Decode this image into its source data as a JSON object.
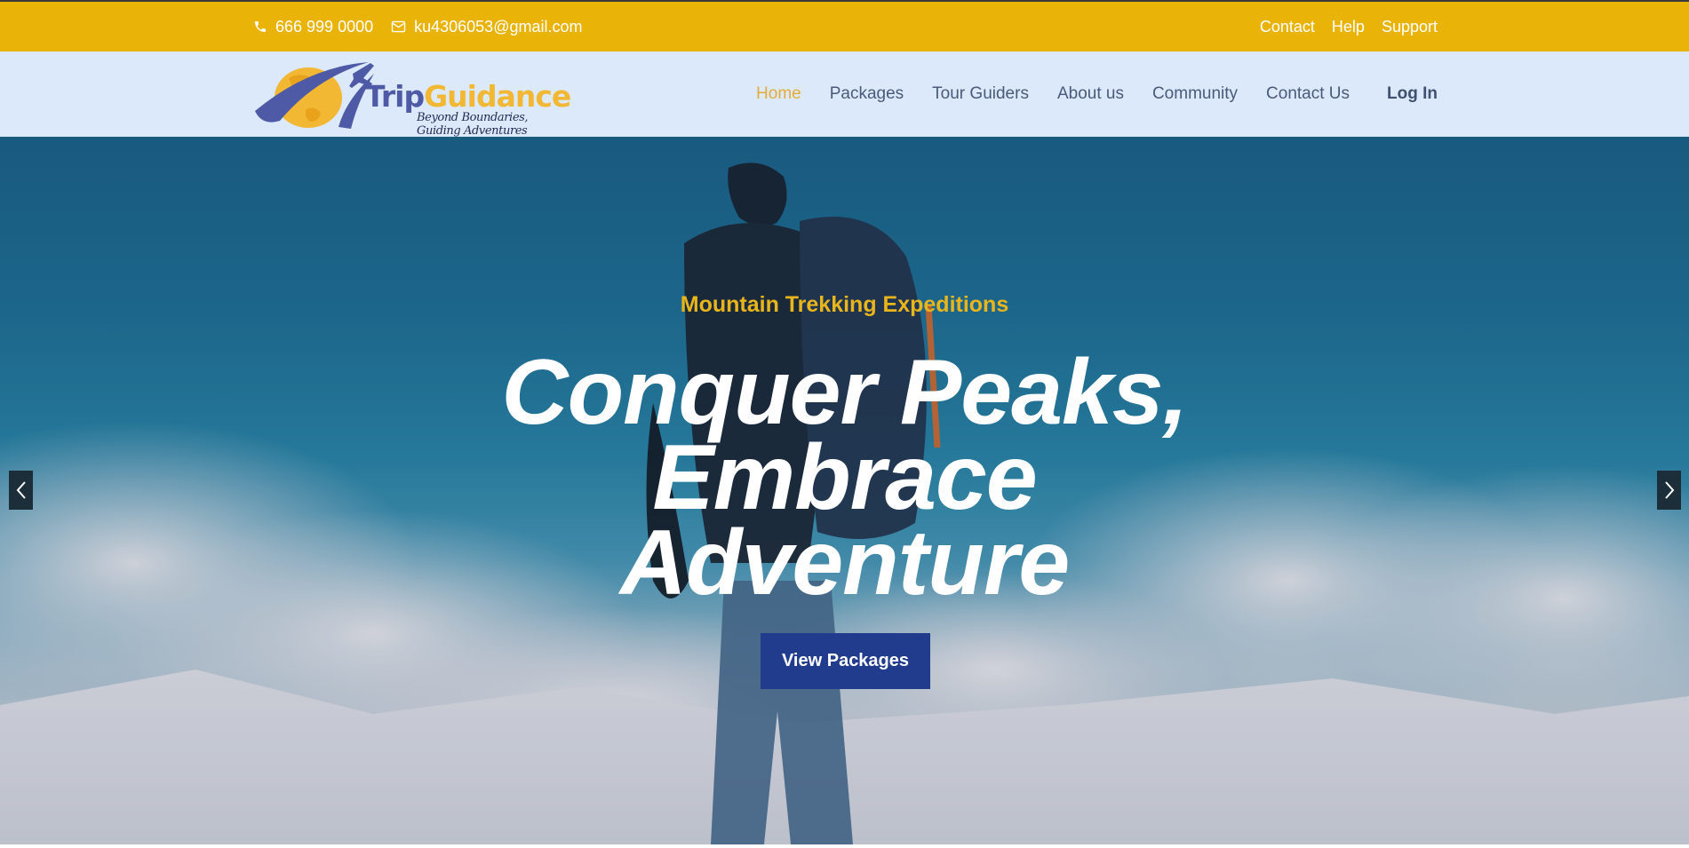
{
  "topbar": {
    "phone": "666 999 0000",
    "email": "ku4306053@gmail.com",
    "links": [
      "Contact",
      "Help",
      "Support"
    ],
    "icons": {
      "phone": "phone-icon",
      "email": "envelope-icon"
    }
  },
  "logo": {
    "brand_part1": "Trip",
    "brand_part2": "Guidance",
    "tagline": "Beyond Boundaries, Guiding Adventures"
  },
  "nav": {
    "items": [
      "Home",
      "Packages",
      "Tour Guiders",
      "About us",
      "Community",
      "Contact Us"
    ],
    "active": "Home",
    "login": "Log In"
  },
  "hero": {
    "subtitle": "Mountain Trekking Expeditions",
    "headline_lines": [
      "Conquer Peaks,",
      "Embrace",
      "Adventure"
    ],
    "cta": "View Packages",
    "prev_icon": "chevron-left-icon",
    "next_icon": "chevron-right-icon"
  },
  "colors": {
    "topbar": "#e9b308",
    "navbar": "#dce9fb",
    "accent": "#e9b51c",
    "cta": "#213c8d",
    "active_nav": "#e5ac3d"
  }
}
